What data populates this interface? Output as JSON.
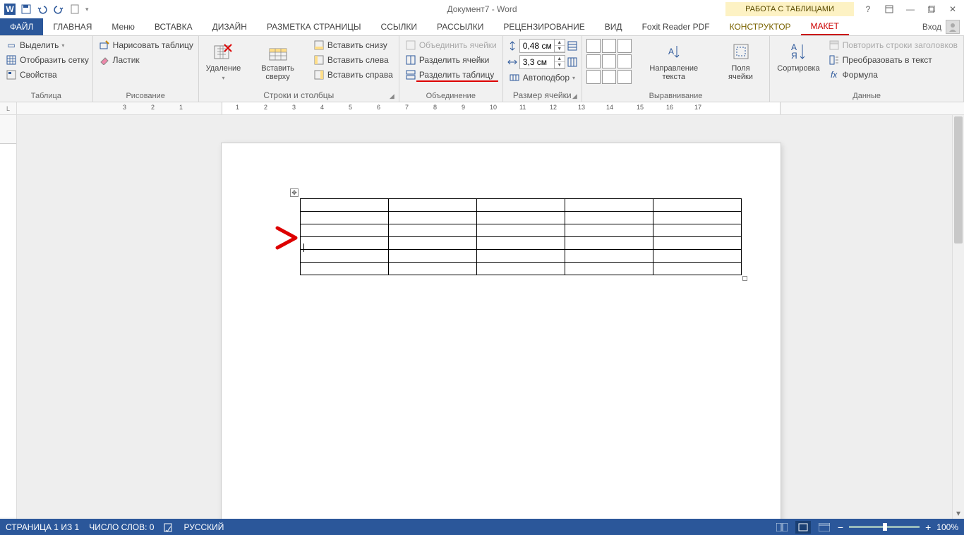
{
  "title": "Документ7 - Word",
  "contextual_title": "РАБОТА С ТАБЛИЦАМИ",
  "tabs": {
    "file": "ФАЙЛ",
    "home": "ГЛАВНАЯ",
    "menu": "Меню",
    "insert": "ВСТАВКА",
    "design": "ДИЗАЙН",
    "layout": "РАЗМЕТКА СТРАНИЦЫ",
    "refs": "ССЫЛКИ",
    "mail": "РАССЫЛКИ",
    "review": "РЕЦЕНЗИРОВАНИЕ",
    "view": "ВИД",
    "foxit": "Foxit Reader PDF",
    "constructor": "КОНСТРУКТОР",
    "maket": "МАКЕТ",
    "signin": "Вход"
  },
  "ribbon": {
    "table": {
      "select": "Выделить",
      "grid": "Отобразить сетку",
      "props": "Свойства",
      "label": "Таблица"
    },
    "draw": {
      "draw": "Нарисовать таблицу",
      "eraser": "Ластик",
      "label": "Рисование"
    },
    "rowcol": {
      "delete": "Удаление",
      "insert_above": "Вставить сверху",
      "insert_below": "Вставить снизу",
      "insert_left": "Вставить слева",
      "insert_right": "Вставить справа",
      "label": "Строки и столбцы"
    },
    "merge": {
      "merge": "Объединить ячейки",
      "split": "Разделить ячейки",
      "split_table": "Разделить таблицу",
      "label": "Объединение"
    },
    "size": {
      "height": "0,48 см",
      "width": "3,3 см",
      "autofit": "Автоподбор",
      "label": "Размер ячейки"
    },
    "align": {
      "direction": "Направление текста",
      "margins": "Поля ячейки",
      "label": "Выравнивание"
    },
    "data": {
      "sort": "Сортировка",
      "repeat": "Повторить строки заголовков",
      "convert": "Преобразовать в текст",
      "formula": "Формула",
      "label": "Данные"
    }
  },
  "status": {
    "page": "СТРАНИЦА 1 ИЗ 1",
    "words": "ЧИСЛО СЛОВ: 0",
    "lang": "РУССКИЙ",
    "zoom": "100%"
  },
  "ruler_marks": [
    "3",
    "2",
    "1",
    "1",
    "2",
    "3",
    "4",
    "5",
    "6",
    "7",
    "8",
    "9",
    "10",
    "11",
    "12",
    "13",
    "14",
    "15",
    "16",
    "17"
  ]
}
